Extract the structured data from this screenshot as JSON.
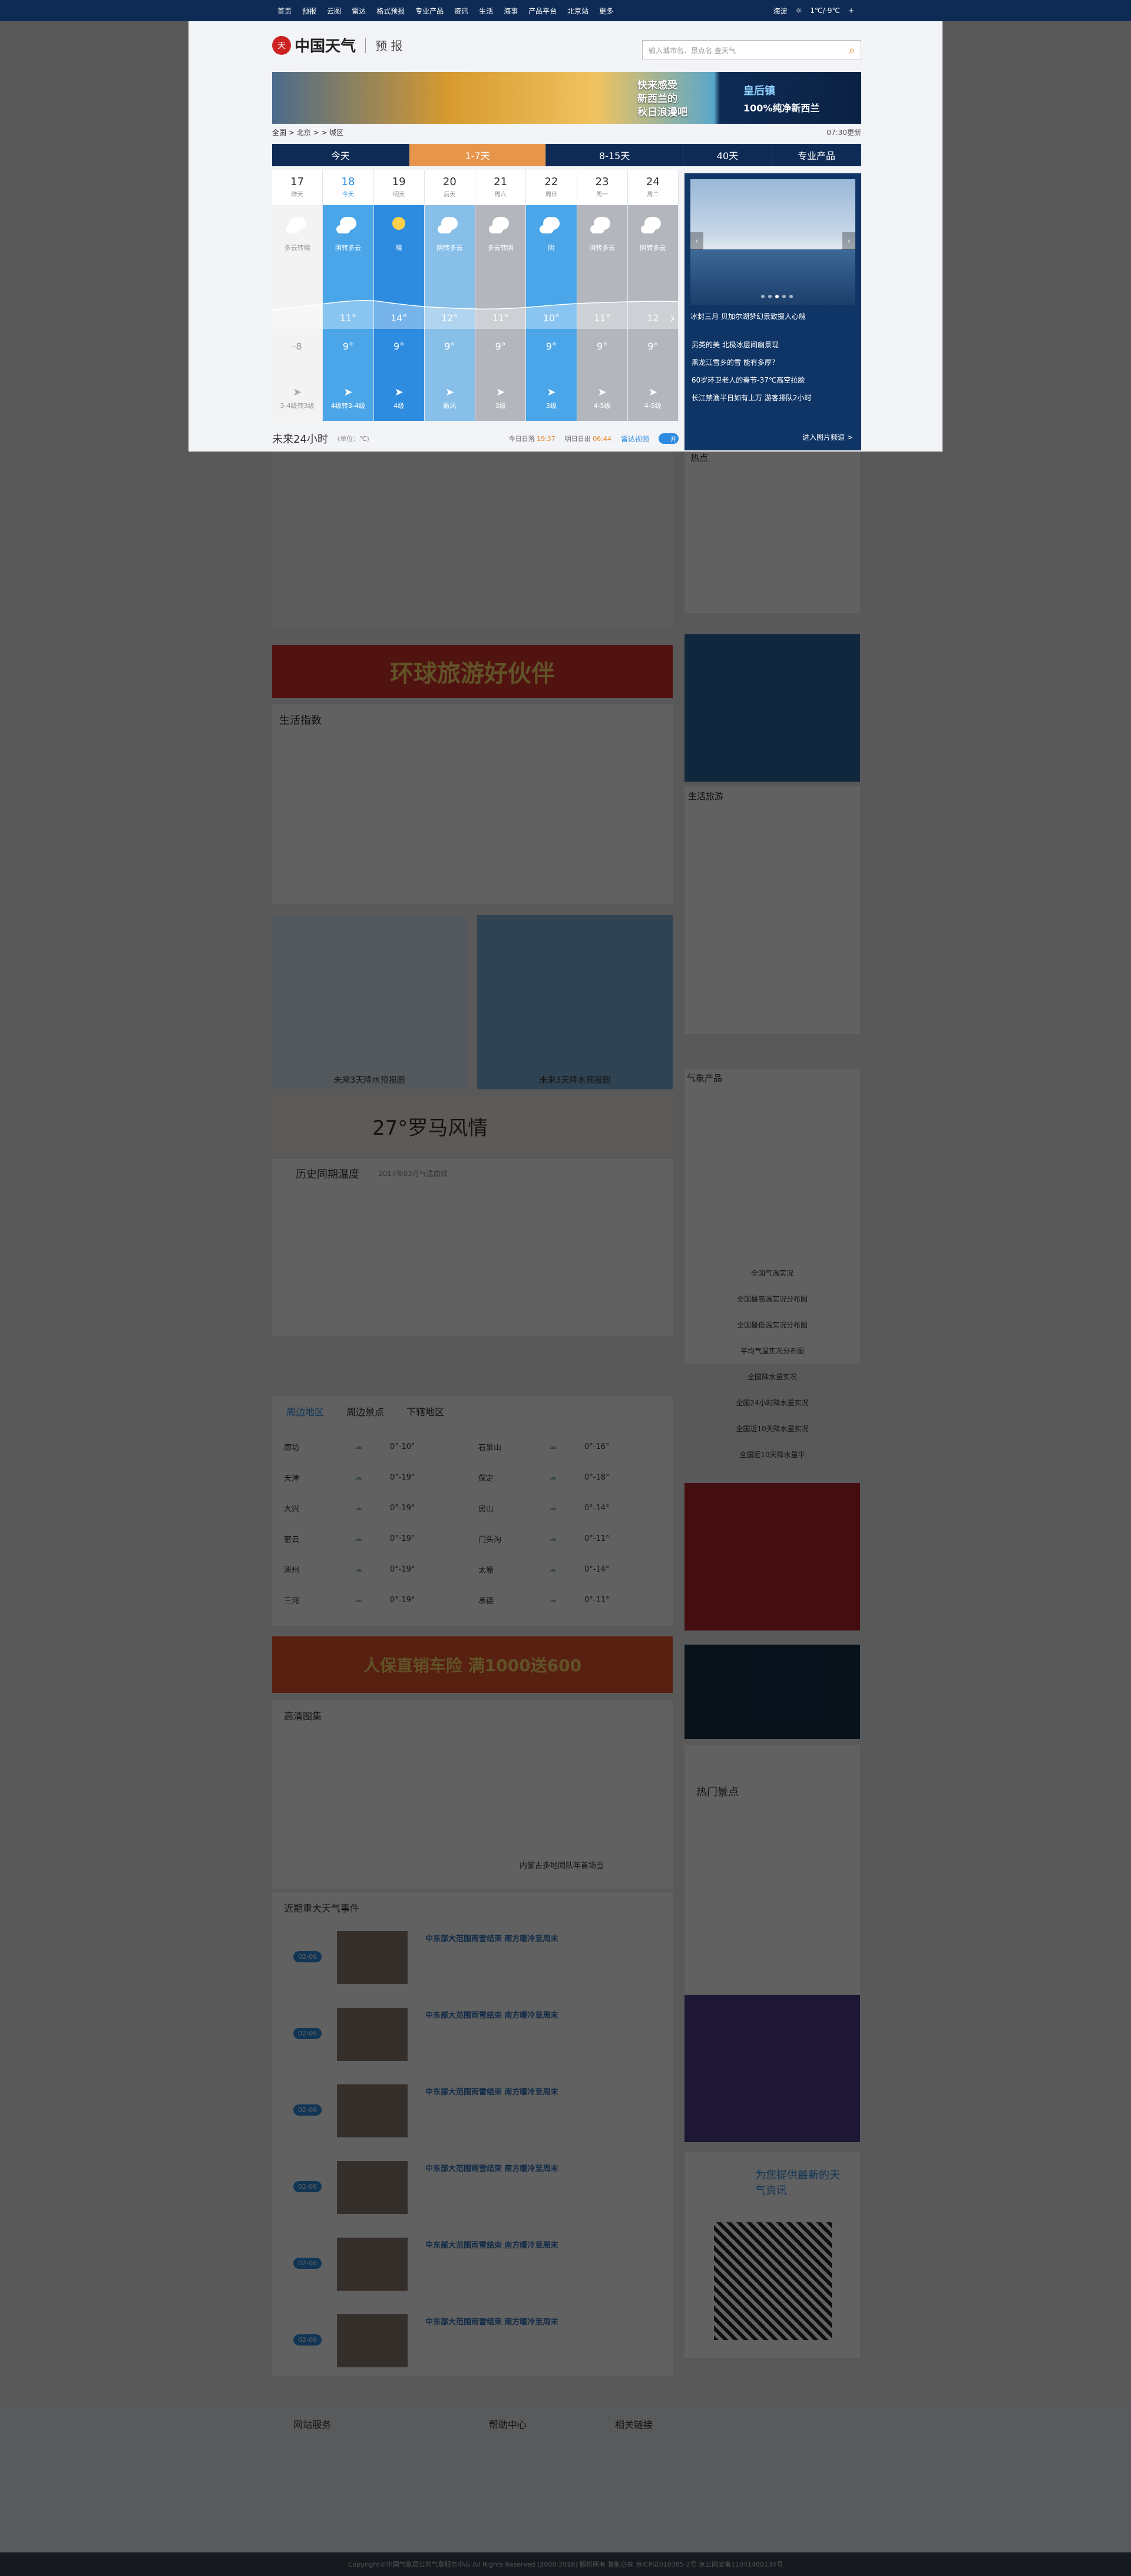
{
  "topbar": {
    "nav": [
      "首页",
      "预报",
      "云图",
      "雷达",
      "格式预报",
      "专业产品",
      "资讯",
      "生活",
      "海事",
      "产品平台",
      "北京站",
      "更多"
    ],
    "location": "海淀",
    "weather": "1℃/-9℃",
    "plus": "+"
  },
  "header": {
    "logo": "中国天气",
    "sub": "预 报",
    "search_placeholder": "输入城市名、景点名 查天气",
    "seal": "天"
  },
  "banner": {
    "line1": "快来感受",
    "line2": "新西兰的",
    "line3": "秋日浪漫吧",
    "brand": "皇后镇",
    "brand2": "100%纯净新西兰"
  },
  "breadcrumb": {
    "path": "全国 > 北京 > > 城区",
    "date": "07:30更新"
  },
  "tabs": [
    "今天",
    "1-7天",
    "8-15天",
    "40天",
    "专业产品"
  ],
  "forecast": {
    "days": [
      {
        "d": "17",
        "w": "昨天",
        "desc": "多云转晴",
        "hi": "",
        "lo": "",
        "wind": "",
        "kind": "past"
      },
      {
        "d": "18",
        "w": "今天",
        "desc": "阴转多云",
        "hi": "11°",
        "lo": "9°",
        "wind": "4级转3-4级",
        "kind": "rain"
      },
      {
        "d": "19",
        "w": "明天",
        "desc": "晴",
        "hi": "14°",
        "lo": "9°",
        "wind": "4级",
        "kind": "sun"
      },
      {
        "d": "20",
        "w": "后天",
        "desc": "阴转多云",
        "hi": "12°",
        "lo": "9°",
        "wind": "微风",
        "kind": "cld"
      },
      {
        "d": "21",
        "w": "周六",
        "desc": "多云转阴",
        "hi": "11°",
        "lo": "9°",
        "wind": "3级",
        "kind": "gray"
      },
      {
        "d": "22",
        "w": "周日",
        "desc": "阴",
        "hi": "10°",
        "lo": "9°",
        "wind": "3级",
        "kind": "rain"
      },
      {
        "d": "23",
        "w": "周一",
        "desc": "阴转多云",
        "hi": "11°",
        "lo": "9°",
        "wind": "4-5级",
        "kind": "gray"
      },
      {
        "d": "24",
        "w": "周二",
        "desc": "阴转多云",
        "hi": "12",
        "lo": "9°",
        "wind": "4-5级",
        "kind": "gray"
      }
    ],
    "past_low": "-8",
    "past_wind": "3-4级转3级",
    "today_low_note": ""
  },
  "hours": {
    "title": "未来24小时",
    "unit": "(单位：℃)",
    "sunrise_label": "今日日落",
    "sunrise": "19:37",
    "sunset_label": "明日日出",
    "sunset": "06:44",
    "radar": "雷达视频",
    "toggle": "开"
  },
  "sidebar": {
    "caption": "冰封三月 贝加尔湖梦幻景致摄人心魄",
    "items": [
      "另类的美 北极冰层间幽景现",
      "黑龙江雪乡的雪 能有多厚？",
      "60岁环卫老人的春节-37℃高空拉脸",
      "长江禁渔半日如有上万 游客排队2小时"
    ],
    "more": "进入图片频道 >"
  },
  "below": {
    "life_index": "生活指数",
    "ad_text": "环球旅游好伙伴",
    "map1": "未来3天降水预报图",
    "map2": "未来3天降水预报图",
    "ad2": "27°罗马风情",
    "history": "历史同期温度",
    "history_sub": "2017年03月气温曲线",
    "nearby_tabs": [
      "周边地区",
      "周边景点",
      "下辖地区"
    ],
    "nearby": [
      [
        "廊坊",
        "0°-10°",
        "石景山",
        "0°-16°"
      ],
      [
        "天津",
        "0°-19°",
        "保定",
        "0°-18°"
      ],
      [
        "大兴",
        "0°-19°",
        "房山",
        "0°-14°"
      ],
      [
        "密云",
        "0°-19°",
        "门头沟",
        "0°-11°"
      ],
      [
        "涿州",
        "0°-19°",
        "太原",
        "0°-14°"
      ],
      [
        "三河",
        "0°-19°",
        "承德",
        "0°-11°"
      ]
    ],
    "ad3": "人保直销车险 满1000送600",
    "hd_title": "高清图集",
    "hd_caption": "内蒙古多地同队年首场雪",
    "events_title": "近期重大天气事件",
    "events": [
      {
        "date": "02-06",
        "title": "中东部大范围雨雪结束 南方暖冷至周末"
      },
      {
        "date": "02-06",
        "title": "中东部大范围雨雪结束 南方暖冷至周末"
      },
      {
        "date": "02-06",
        "title": "中东部大范围雨雪结束 南方暖冷至周末"
      },
      {
        "date": "02-06",
        "title": "中东部大范围雨雪结束 南方暖冷至周末"
      },
      {
        "date": "02-06",
        "title": "中东部大范围雨雪结束 南方暖冷至周末"
      },
      {
        "date": "02-06",
        "title": "中东部大范围雨雪结束 南方暖冷至周末"
      }
    ],
    "right_hot": "热点",
    "right_life": "生活旅游",
    "right_prod": "气象产品",
    "right_links": [
      "全国气温实况",
      "全国最高温实况分布图",
      "全国最低温实况分布图",
      "平均气温实况分布图",
      "全国降水量实况",
      "全国24小时降水量实况",
      "全国近10天降水量实况",
      "全国近10天降水量平"
    ],
    "qr_title": "为您提供最新的天气资讯",
    "hot_scenic": "热门景点"
  },
  "footer": {
    "col1": "网站服务",
    "col2": "帮助中心",
    "col3": "相关链接",
    "copyright": "Copyright©中国气象局公共气象服务中心 All Rights Reserved (2008-2018) 版权所有 复制必究 京ICP证010385-2号 京公网安备11041400134号"
  }
}
